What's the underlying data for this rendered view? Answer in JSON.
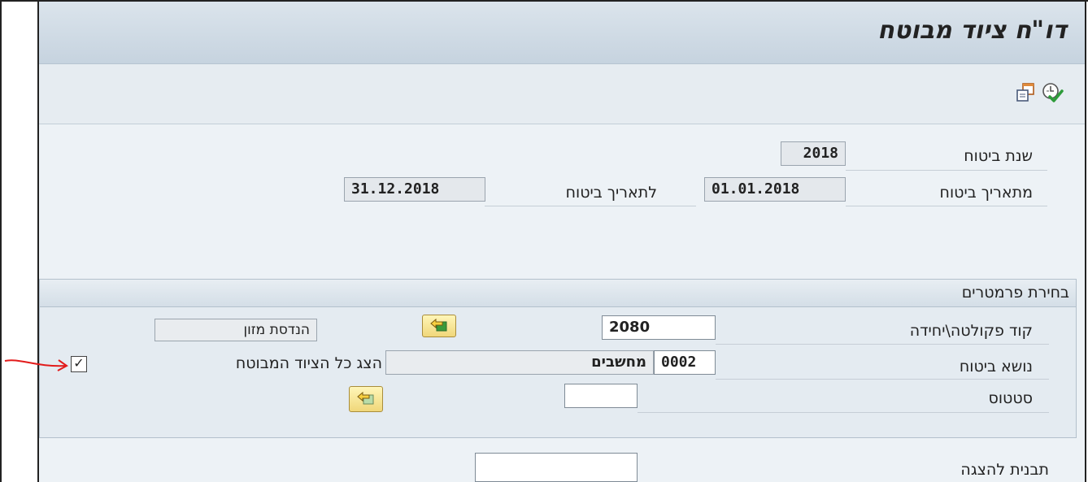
{
  "window": {
    "title": "דו\"ח ציוד מבוטח"
  },
  "toolbar": {
    "icons": [
      "execute-icon",
      "copy-variant-icon"
    ]
  },
  "insurance": {
    "year_label": "שנת ביטוח",
    "year_value": "2018",
    "from_label": "מתאריך ביטוח",
    "from_value": "01.01.2018",
    "to_label": "לתאריך ביטוח",
    "to_value": "31.12.2018"
  },
  "params": {
    "section_title": "בחירת פרמטרים",
    "faculty_label": "קוד פקולטה\\יחידה",
    "faculty_value": "2080",
    "faculty_name": "הנדסת מזון",
    "subject_label": "נושא ביטוח",
    "subject_code": "0002",
    "subject_name": "מחשבים",
    "show_all_label": "הצג כל הציוד המבוטח",
    "show_all_checked": true,
    "status_label": "סטטוס",
    "status_value": ""
  },
  "layout_field": {
    "label": "תבנית להצגה",
    "value": ""
  },
  "colors": {
    "annotation_arrow": "#e21b1b",
    "button_yellow": "#f0d77a"
  }
}
